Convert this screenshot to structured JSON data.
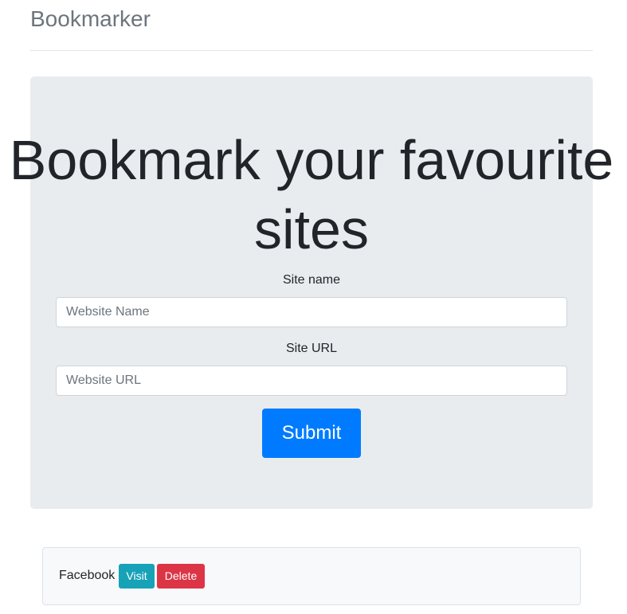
{
  "header": {
    "brand": "Bookmarker"
  },
  "jumbotron": {
    "title": "Bookmark your favourite sites",
    "site_name": {
      "label": "Site name",
      "placeholder": "Website Name",
      "value": ""
    },
    "site_url": {
      "label": "Site URL",
      "placeholder": "Website URL",
      "value": ""
    },
    "submit_label": "Submit"
  },
  "bookmarks": [
    {
      "name": "Facebook",
      "visit_label": "Visit",
      "delete_label": "Delete"
    }
  ],
  "colors": {
    "primary": "#007bff",
    "info": "#17a2b8",
    "danger": "#dc3545",
    "jumbotron_bg": "#e9ecef",
    "card_bg": "#f8f9fa",
    "brand_text": "#6c757d"
  }
}
